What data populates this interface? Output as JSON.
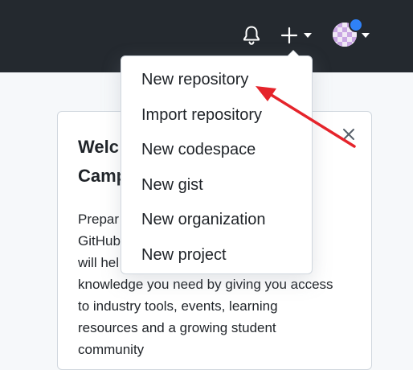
{
  "header": {
    "notifications_icon": "bell-icon",
    "create_icon": "plus-icon",
    "create_caret_icon": "caret-down-icon",
    "avatar_caret_icon": "caret-down-icon",
    "unread_dot_color": "#2f81f7",
    "background_color": "#24292f"
  },
  "welcome_card": {
    "title_lines": [
      "Welc",
      "Camp"
    ],
    "close_icon": "close-icon",
    "body_lines": [
      "Prepar… g",
      "GitHub… us",
      "will hel… y",
      "knowledge you need by giving you access",
      "to industry tools, events, learning",
      "resources and a growing student",
      "community"
    ]
  },
  "create_menu": {
    "items": [
      {
        "label": "New repository"
      },
      {
        "label": "Import repository"
      },
      {
        "label": "New codespace"
      },
      {
        "label": "New gist"
      },
      {
        "label": "New organization"
      },
      {
        "label": "New project"
      }
    ]
  },
  "annotation": {
    "type": "arrow",
    "color": "#e5242b",
    "points_to": "New repository"
  }
}
